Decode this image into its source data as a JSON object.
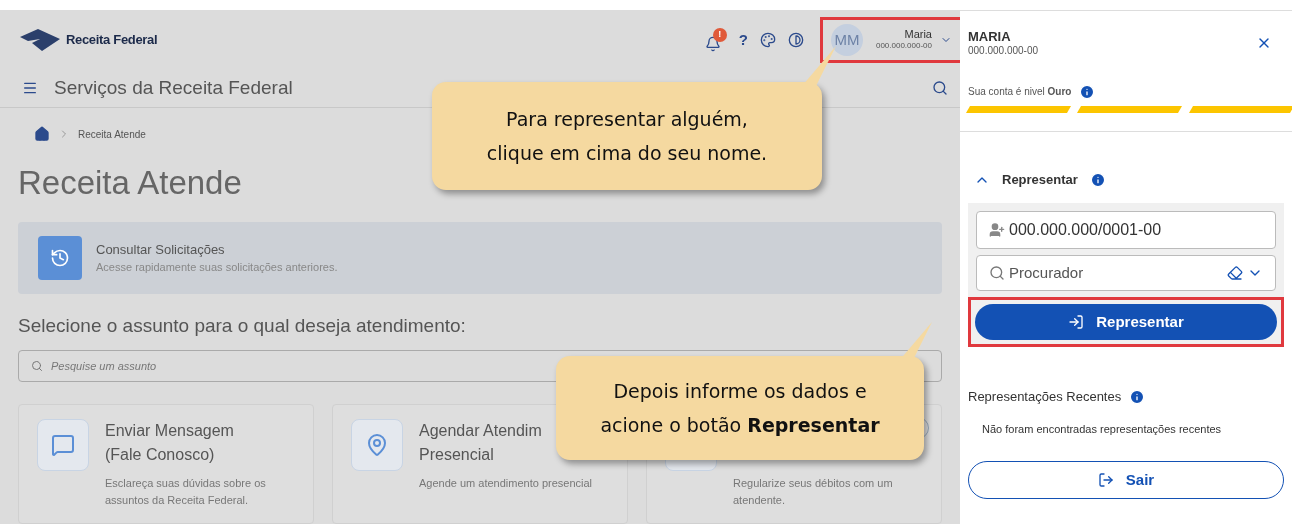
{
  "header": {
    "logo_text": "Receita Federal",
    "notification_badge": "!",
    "help": "?",
    "user": {
      "initials": "MM",
      "name": "Maria",
      "cpf": "000.000.000-00",
      "highlighted": true
    }
  },
  "nav": {
    "title": "Serviços da Receita Federal"
  },
  "breadcrumb": [
    "Receita Atende"
  ],
  "page_title": "Receita Atende",
  "quick_card": {
    "title": "Consultar Solicitações",
    "subtitle": "Acesse rapidamente suas solicitações anteriores."
  },
  "section_heading": "Selecione o assunto para o qual deseja atendimento:",
  "subject_search": {
    "placeholder": "Pesquise um assunto"
  },
  "cards": [
    {
      "kind": "message",
      "title_lines": [
        "Enviar Mensagem",
        "(Fale Conosco)"
      ],
      "description": "Esclareça suas dúvidas sobre os assuntos da Receita Federal.",
      "locked": false
    },
    {
      "kind": "calendar",
      "title_lines": [
        "Agendar Atendim",
        "Presencial"
      ],
      "description": "Agende um atendimento presencial",
      "locked": false
    },
    {
      "kind": "chat",
      "description": "Regularize seus débitos com um atendente.",
      "locked": true
    }
  ],
  "callouts": [
    {
      "lines": [
        "Para representar alguém,",
        "clique em cima do seu nome."
      ]
    },
    {
      "lines": [
        "Depois informe os dados e",
        "acione o botão **Representar**"
      ]
    }
  ],
  "panel": {
    "name": "MARIA",
    "cpf": "000.000.000-00",
    "level_text": "Sua conta é nivel **Ouro**",
    "level_segments": [
      {
        "filled": true
      },
      {
        "filled": true
      },
      {
        "filled": true
      }
    ],
    "represent": {
      "label": "Representar",
      "expanded": true,
      "cnpj": "000.000.000/0001-00",
      "procurador_placeholder": "Procurador",
      "button": "Representar",
      "highlighted": true
    },
    "recent_heading": "Representações Recentes",
    "recent_empty": "Não foram encontradas representações recentes",
    "logout": "Sair"
  }
}
